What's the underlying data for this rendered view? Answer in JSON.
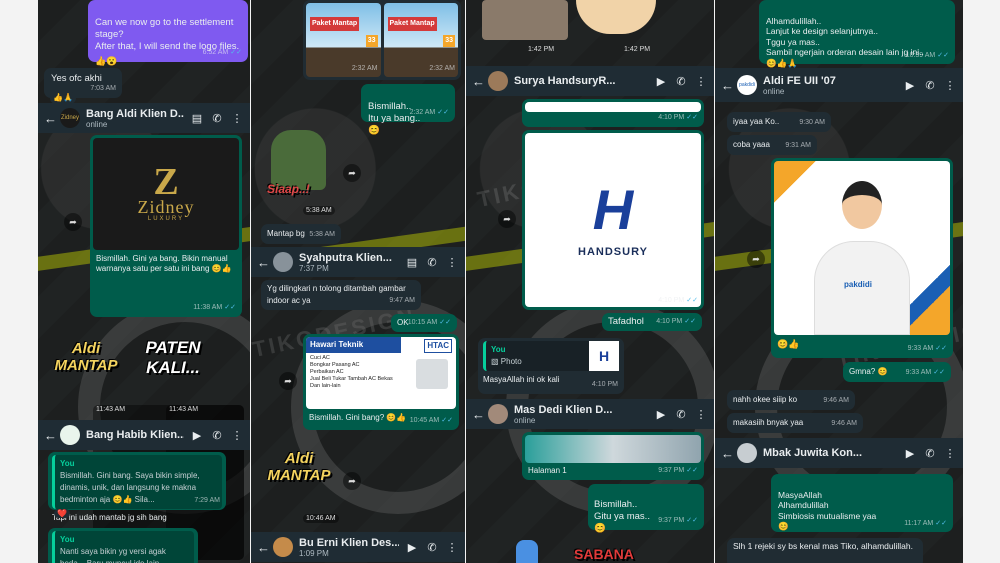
{
  "col1": {
    "msg_stage": "Can we now go to the settlement stage?\nAfter that, I will send the logo files.",
    "msg_stage_time": "6:52 AM",
    "msg_stage_reacts": "👍😮",
    "msg_yes": "Yes ofc akhi",
    "msg_yes_reacts": "👍🙏",
    "msg_yes_time": "7:03 AM",
    "chat1_name": "Bang Aldi Klien D...",
    "chat1_status": "online",
    "chat1_avatar": "Zidney",
    "zidney_brand": "Zidney",
    "zidney_sub": "LUXURY",
    "msg_bismillah": "Bismillah. Gini ya bang. Bikin manual warnanya satu per satu ini bang 😊👍",
    "msg_bismillah_time": "11:38 AM",
    "sticker_mantap": "Aldi MANTAP",
    "sticker_paten": "PATEN KALI...",
    "sticker_time_1": "11:43 AM",
    "sticker_time_2": "11:43 AM",
    "chat2_name": "Bang Habib Klien...",
    "quote_you": "You",
    "quote_text": "Bismillah. Gini bang. Saya bikin simple, dinamis, unik, dan langsung ke makna bedminton aja 😊👍 Sila...",
    "msg_tapi": "Tapi ini udah mantab jg sih bang",
    "msg_tapi_time": "7:29 AM",
    "msg_tapi_react": "❤️",
    "quote2_you": "You",
    "quote2_text": "Nanti saya bikin yg versi agak beda... Baru muncul ide lain..."
  },
  "col2": {
    "poster_title": "Paket Mantap",
    "poster_badge": "33",
    "poster_time_1": "2:32 AM",
    "poster_time_2": "2:32 AM",
    "msg_bismillah": "Bismillah..\nItu ya bang..\n😊",
    "msg_bismillah_time": "2:32 AM",
    "sticker_siaap": "Siaap..!",
    "sticker_time": "5:38 AM",
    "msg_mantap": "Mantap bg",
    "msg_mantap_time": "5:38 AM",
    "chat_name": "Syahputra Klien...",
    "chat_time": "7:37 PM",
    "msg_yg": "Yg dilingkari n tolong ditambah gambar indoor ac ya",
    "msg_yg_time": "9:47 AM",
    "msg_ok": "OK",
    "msg_ok_time": "10:15 AM",
    "banner_title": "Hawari Teknik",
    "banner_logo": "HTAC",
    "banner_items": [
      "Cuci AC",
      "Bongkar Pasang AC",
      "Perbaikan AC",
      "Jual Beli Tukar Tambah AC Bekas",
      "Dan lain-lain"
    ],
    "msg_bismillah2": "Bismillah. Gini bang? 😊👍",
    "msg_bismillah2_time": "10:45 AM",
    "sticker_mantap2": "Aldi MANTAP",
    "sticker_mantap2_time": "10:46 AM",
    "chat2_name": "Bu Erni Klien Des...",
    "chat2_time": "1:09 PM"
  },
  "col3": {
    "top_time_1": "1:42 PM",
    "top_time_2": "1:42 PM",
    "chat_name": "Surya HandsuryR...",
    "img1_time": "4:10 PM",
    "handsury_brand": "HANDSURY",
    "img2_time": "4:10 PM",
    "msg_tafadhol": "Tafadhol",
    "msg_tafadhol_time": "4:10 PM",
    "quote_you": "You",
    "quote_photo": "▧ Photo",
    "msg_masya": "MasyaAllah ini ok kali",
    "msg_masya_time": "4:10 PM",
    "chat2_name": "Mas Dedi Klien D...",
    "chat2_status": "online",
    "halaman": "Halaman 1",
    "halaman_time": "9:37 PM",
    "msg_bismillah": "Bismillah..\nGitu ya mas..\n😊",
    "msg_bismillah_time": "9:37 PM",
    "bottom_text": "SABANA"
  },
  "col4": {
    "msg_top": "Alhamdulillah..\nLanjut ke design selanjutnya..\nTggu ya mas..\nSambil ngerjain orderan desain lain jg ini..\n😊👍🙏",
    "msg_top_time": "10:39 AM",
    "chat_name": "Aldi FE UII '07",
    "chat_status": "online",
    "chat_avatar": "pakdidi",
    "msg_iyaa": "iyaa yaa Ko..",
    "msg_iyaa_time": "9:30 AM",
    "msg_coba": "coba yaaa",
    "msg_coba_time": "9:31 AM",
    "pakdidi_logo": "pakdidi",
    "img_react": "😊👍",
    "img_time": "9:33 AM",
    "msg_gmna": "Gmna? 😊",
    "msg_gmna_time": "9:33 AM",
    "msg_nahh": "nahh okee siiip ko",
    "msg_nahh_time": "9:46 AM",
    "msg_makasih": "makasiih bnyak yaa",
    "msg_makasih_time": "9:46 AM",
    "chat2_name": "Mbak Juwita Kon...",
    "msg_masya": "MasyaAllah\nAlhamdulillah\nSimbiosis mutualisme yaa\n😊",
    "msg_masya_time": "11:17 AM",
    "msg_slh": "Slh 1 rejeki sy bs kenal mas Tiko, alhamdulillah."
  },
  "watermark": "TIKODESIGN"
}
